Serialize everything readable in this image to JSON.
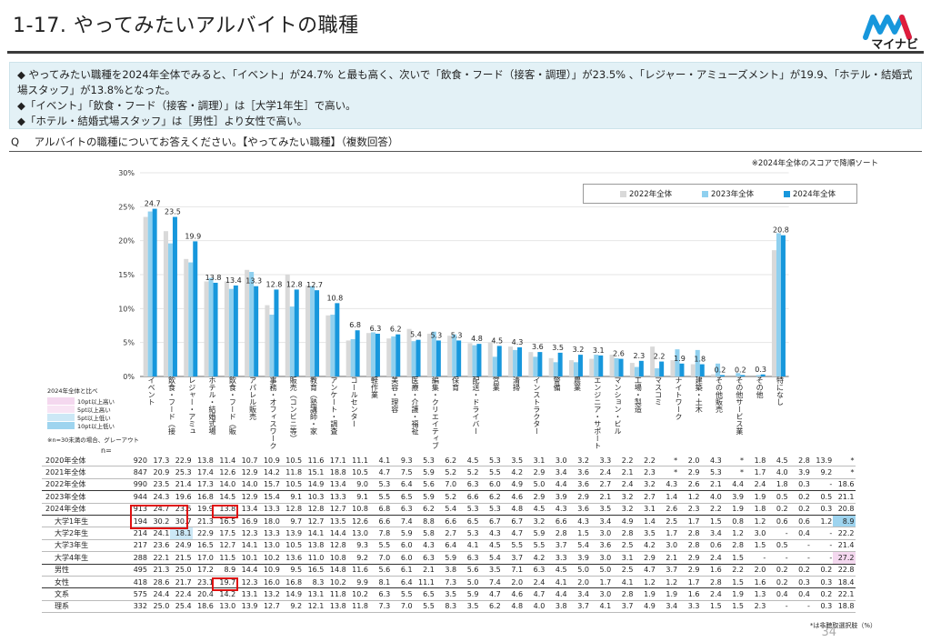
{
  "header": {
    "title": "1-17.  やってみたいアルバイトの職種",
    "logo_text": "マイナビ"
  },
  "summary": {
    "lines": [
      "◆ やってみたい職種を2024年全体でみると、「イベント」が24.7% と最も高く、次いで「飲食・フード（接客・調理）」が23.5% 、「レジャー・アミューズメント」が19.9、「ホテル・結婚式場スタッフ」が13.8%となった。",
      "◆「イベント」「飲食・フード（接客・調理）」は［大学1年生］で高い。",
      "◆「ホテル・結婚式場スタッフ」は［男性］より女性で高い。"
    ]
  },
  "question": {
    "prefix": "Q",
    "text": "アルバイトの職種についてお答えください。【やってみたい職種】（複数回答）"
  },
  "sort_note": "※2024年全体のスコアで降順ソート",
  "legend_key": {
    "title": "2024年全体と比べ",
    "items": [
      "10pt以上高い",
      "5pt以上高い",
      "5pt以上低い",
      "10pt以上低い"
    ],
    "note": "※n=30未満の場合、グレーアウト",
    "colors": [
      "#f4d8ef",
      "#f8e4f4",
      "#cce8f6",
      "#9ed4ef"
    ]
  },
  "n_label": "n=",
  "footnote": "*は非聴取選択肢（%）",
  "page_number": "34",
  "chart_data": {
    "type": "bar",
    "ylim": [
      0,
      30
    ],
    "yticks": [
      "0%",
      "5%",
      "10%",
      "15%",
      "20%",
      "25%",
      "30%"
    ],
    "series": [
      {
        "name": "2022年全体",
        "color": "#d9d9d9",
        "values": [
          23.5,
          21.4,
          17.3,
          14.0,
          14.0,
          15.7,
          10.5,
          15.0,
          13.4,
          9.0,
          5.3,
          6.4,
          5.6,
          7.0,
          6.3,
          6.0,
          4.9,
          5.0,
          4.4,
          3.6,
          2.7,
          2.4,
          2.6,
          3.2,
          2.0,
          4.4,
          2.4,
          1.8,
          0.3,
          null,
          null,
          18.6
        ]
      },
      {
        "name": "2023年全体",
        "color": "#8fd0ef",
        "values": [
          24.3,
          19.6,
          16.8,
          14.5,
          12.9,
          15.4,
          9.1,
          10.3,
          13.3,
          9.1,
          5.5,
          6.5,
          5.9,
          5.2,
          6.6,
          6.2,
          4.6,
          2.9,
          3.9,
          2.9,
          2.1,
          2.1,
          3.2,
          2.7,
          1.4,
          1.2,
          4.0,
          3.9,
          1.9,
          0.5,
          0.2,
          21.1
        ]
      },
      {
        "name": "2024年全体",
        "color": "#1797dc",
        "values": [
          24.7,
          23.5,
          19.9,
          13.8,
          13.4,
          13.3,
          12.8,
          12.8,
          12.7,
          10.8,
          6.8,
          6.3,
          6.2,
          5.4,
          5.3,
          5.3,
          4.8,
          4.5,
          4.3,
          3.6,
          3.5,
          3.2,
          3.1,
          2.6,
          2.3,
          2.2,
          1.9,
          1.8,
          0.2,
          0.2,
          0.3,
          20.8
        ]
      }
    ],
    "categories": [
      "イベント",
      "飲食・フード（接客・調理）",
      "レジャー・アミューズメント",
      "ホテル・結婚式場スタッフ",
      "飲食・フード（販売）",
      "アパレル販売",
      "事務・オフィスワーク",
      "販売（コンビニエンスストア・スーパーマーケット）",
      "教育（塾講師・家庭教師等）",
      "アンケート・調査",
      "コールセンター",
      "軽作業",
      "美容・理容",
      "医療・介護・福祉",
      "編集・クリエイティブ",
      "保育",
      "配送・ドライバー",
      "営業",
      "清掃",
      "インストラクター",
      "警備",
      "農業",
      "エンジニア・ポート・保守",
      "マンション・ビル管理",
      "工場・製造",
      "マスコミ",
      "ナイトワーク",
      "建築・土木",
      "その他販売",
      "その他サービス業",
      "その他",
      "特になし"
    ],
    "cat_labels": [
      "イベント",
      "飲食・フード（接",
      "レジャー・アミュ",
      "ホテル・結婚式場",
      "飲食・フード（販",
      "アパレル販売",
      "事務・オフィスワーク",
      "販売（コンビニ等）",
      "教育（塾講師・家",
      "アンケート・調査",
      "コールセンター",
      "軽作業",
      "美容・理容",
      "医療・介護・福祉",
      "編集・クリエイティブ",
      "保育",
      "配送・ドライバー",
      "営業",
      "清掃",
      "インストラクター",
      "警備",
      "農業",
      "エンジニア・サポート",
      "マンション・ビル",
      "工場・製造",
      "マスコミ",
      "ナイトワーク",
      "建築・土木",
      "その他販売",
      "その他サービス業",
      "その他",
      "特になし"
    ],
    "labels_2024": [
      "24.7",
      "23.5",
      "19.9",
      "13.8",
      "13.4",
      "13.3",
      "12.8",
      "12.8",
      "12.7",
      "10.8",
      "6.8",
      "6.3",
      "6.2",
      "5.4",
      "5.3",
      "5.3",
      "4.8",
      "4.5",
      "4.3",
      "3.6",
      "3.5",
      "3.2",
      "3.1",
      "2.6",
      "2.3",
      "2.2",
      "1.9",
      "1.8",
      "0.2",
      "0.2",
      "0.3",
      "20.8"
    ]
  },
  "table": {
    "rows": [
      {
        "label": "2020年全体",
        "n": "920",
        "vals": [
          "17.3",
          "22.9",
          "13.8",
          "11.4",
          "10.7",
          "10.9",
          "10.5",
          "11.6",
          "17.1",
          "11.1",
          "4.1",
          "9.3",
          "5.3",
          "6.2",
          "4.5",
          "5.3",
          "3.5",
          "3.1",
          "3.0",
          "3.2",
          "3.3",
          "2.2",
          "2.2",
          "*",
          "2.0",
          "4.3",
          "*",
          "1.8",
          "4.5",
          "2.8",
          "13.9",
          "*"
        ]
      },
      {
        "label": "2021年全体",
        "n": "847",
        "vals": [
          "20.9",
          "25.3",
          "17.4",
          "12.6",
          "12.9",
          "14.2",
          "11.8",
          "15.1",
          "18.8",
          "10.5",
          "4.7",
          "7.5",
          "5.9",
          "5.2",
          "5.2",
          "5.5",
          "4.2",
          "2.9",
          "3.4",
          "3.6",
          "2.4",
          "2.1",
          "2.3",
          "*",
          "2.9",
          "5.3",
          "*",
          "1.7",
          "4.0",
          "3.9",
          "9.2",
          "*"
        ]
      },
      {
        "label": "2022年全体",
        "n": "990",
        "sep": true,
        "vals": [
          "23.5",
          "21.4",
          "17.3",
          "14.0",
          "14.0",
          "15.7",
          "10.5",
          "14.9",
          "13.4",
          "9.0",
          "5.3",
          "6.4",
          "5.6",
          "7.0",
          "6.3",
          "6.0",
          "4.9",
          "5.0",
          "4.4",
          "3.6",
          "2.7",
          "2.4",
          "3.2",
          "4.3",
          "2.6",
          "2.1",
          "4.4",
          "2.4",
          "1.8",
          "0.3",
          "-",
          "18.6"
        ]
      },
      {
        "label": "2023年全体",
        "n": "944",
        "vals": [
          "24.3",
          "19.6",
          "16.8",
          "14.5",
          "12.9",
          "15.4",
          "9.1",
          "10.3",
          "13.3",
          "9.1",
          "5.5",
          "6.5",
          "5.9",
          "5.2",
          "6.6",
          "6.2",
          "4.6",
          "2.9",
          "3.9",
          "2.9",
          "2.1",
          "3.2",
          "2.7",
          "1.4",
          "1.2",
          "4.0",
          "3.9",
          "1.9",
          "0.5",
          "0.2",
          "0.5",
          "21.1"
        ]
      },
      {
        "label": "2024年全体",
        "n": "913",
        "sep": true,
        "vals": [
          "24.7",
          "23.5",
          "19.9",
          "13.8",
          "13.4",
          "13.3",
          "12.8",
          "12.8",
          "12.7",
          "10.8",
          "6.8",
          "6.3",
          "6.2",
          "5.4",
          "5.3",
          "5.3",
          "4.8",
          "4.5",
          "4.3",
          "3.6",
          "3.5",
          "3.2",
          "3.1",
          "2.6",
          "2.3",
          "2.2",
          "1.9",
          "1.8",
          "0.2",
          "0.2",
          "0.3",
          "20.8"
        ]
      },
      {
        "label": "大学1年生",
        "n": "194",
        "indent": true,
        "vals": [
          "30.2",
          "30.7",
          "21.3",
          "16.5",
          "16.9",
          "18.0",
          "9.7",
          "12.7",
          "13.5",
          "12.6",
          "6.6",
          "7.4",
          "8.8",
          "6.6",
          "6.5",
          "6.7",
          "6.7",
          "3.2",
          "6.6",
          "4.3",
          "3.4",
          "4.9",
          "1.4",
          "2.5",
          "1.7",
          "1.5",
          "0.8",
          "1.2",
          "0.6",
          "0.6",
          "1.2",
          "8.9"
        ],
        "hl": {
          "31": "hl-blue"
        }
      },
      {
        "label": "大学2年生",
        "n": "214",
        "indent": true,
        "vals": [
          "24.1",
          "18.1",
          "22.9",
          "17.5",
          "12.3",
          "13.3",
          "13.9",
          "14.1",
          "14.4",
          "13.0",
          "7.8",
          "5.9",
          "5.8",
          "2.7",
          "5.3",
          "4.3",
          "4.7",
          "5.9",
          "2.8",
          "1.5",
          "3.0",
          "2.8",
          "3.5",
          "1.7",
          "2.8",
          "3.4",
          "1.2",
          "3.0",
          "-",
          "0.4",
          "-",
          "22.2"
        ],
        "hl": {
          "1": "hl-lblue"
        }
      },
      {
        "label": "大学3年生",
        "n": "217",
        "indent": true,
        "vals": [
          "23.6",
          "24.9",
          "16.5",
          "12.7",
          "14.1",
          "13.0",
          "10.5",
          "13.8",
          "12.8",
          "9.3",
          "5.5",
          "6.0",
          "4.3",
          "6.4",
          "4.1",
          "4.5",
          "5.5",
          "5.5",
          "3.7",
          "5.4",
          "3.6",
          "2.5",
          "4.2",
          "3.0",
          "2.8",
          "0.6",
          "2.8",
          "1.5",
          "0.5",
          "-",
          "-",
          "21.4"
        ]
      },
      {
        "label": "大学4年生",
        "n": "288",
        "indent": true,
        "sep": true,
        "vals": [
          "22.1",
          "21.5",
          "17.0",
          "11.5",
          "10.1",
          "10.2",
          "13.6",
          "11.0",
          "10.8",
          "9.2",
          "7.0",
          "6.0",
          "6.3",
          "5.9",
          "6.3",
          "5.4",
          "3.7",
          "4.2",
          "3.3",
          "3.9",
          "3.0",
          "3.1",
          "2.9",
          "2.1",
          "2.9",
          "2.4",
          "1.5",
          "-",
          "-",
          "-",
          "-",
          "27.2"
        ],
        "hl": {
          "31": "hl-pink"
        }
      },
      {
        "label": "男性",
        "n": "495",
        "indent": true,
        "vals": [
          "21.3",
          "25.0",
          "17.2",
          "8.9",
          "14.4",
          "10.9",
          "9.5",
          "16.5",
          "14.8",
          "11.6",
          "5.6",
          "6.1",
          "2.1",
          "3.8",
          "5.6",
          "3.5",
          "7.1",
          "6.3",
          "4.5",
          "5.0",
          "5.0",
          "2.5",
          "4.7",
          "3.7",
          "2.9",
          "1.6",
          "2.2",
          "2.0",
          "0.2",
          "0.2",
          "0.2",
          "22.8"
        ]
      },
      {
        "label": "女性",
        "n": "418",
        "indent": true,
        "sep": true,
        "vals": [
          "28.6",
          "21.7",
          "23.1",
          "19.7",
          "12.3",
          "16.0",
          "16.8",
          "8.3",
          "10.2",
          "9.9",
          "8.1",
          "6.4",
          "11.1",
          "7.3",
          "5.0",
          "7.4",
          "2.0",
          "2.4",
          "4.1",
          "2.0",
          "1.7",
          "4.1",
          "1.2",
          "1.2",
          "1.7",
          "2.8",
          "1.5",
          "1.6",
          "0.2",
          "0.3",
          "0.3",
          "18.4"
        ]
      },
      {
        "label": "文系",
        "n": "575",
        "indent": true,
        "vals": [
          "24.4",
          "22.4",
          "20.4",
          "14.2",
          "13.1",
          "13.2",
          "14.9",
          "13.1",
          "11.8",
          "10.2",
          "6.3",
          "5.5",
          "6.5",
          "3.5",
          "5.9",
          "4.7",
          "4.6",
          "4.7",
          "4.4",
          "3.4",
          "3.0",
          "2.8",
          "1.9",
          "1.9",
          "1.6",
          "2.4",
          "1.9",
          "1.3",
          "0.4",
          "0.4",
          "0.2",
          "22.1"
        ]
      },
      {
        "label": "理系",
        "n": "332",
        "indent": true,
        "vals": [
          "25.0",
          "25.4",
          "18.6",
          "13.0",
          "13.9",
          "12.7",
          "9.2",
          "12.1",
          "13.8",
          "11.8",
          "7.3",
          "7.0",
          "5.5",
          "8.3",
          "3.5",
          "6.2",
          "4.8",
          "4.0",
          "3.8",
          "3.7",
          "4.1",
          "3.7",
          "4.9",
          "3.4",
          "3.3",
          "1.5",
          "1.5",
          "2.3",
          "-",
          "-",
          "0.3",
          "18.8"
        ]
      }
    ]
  }
}
